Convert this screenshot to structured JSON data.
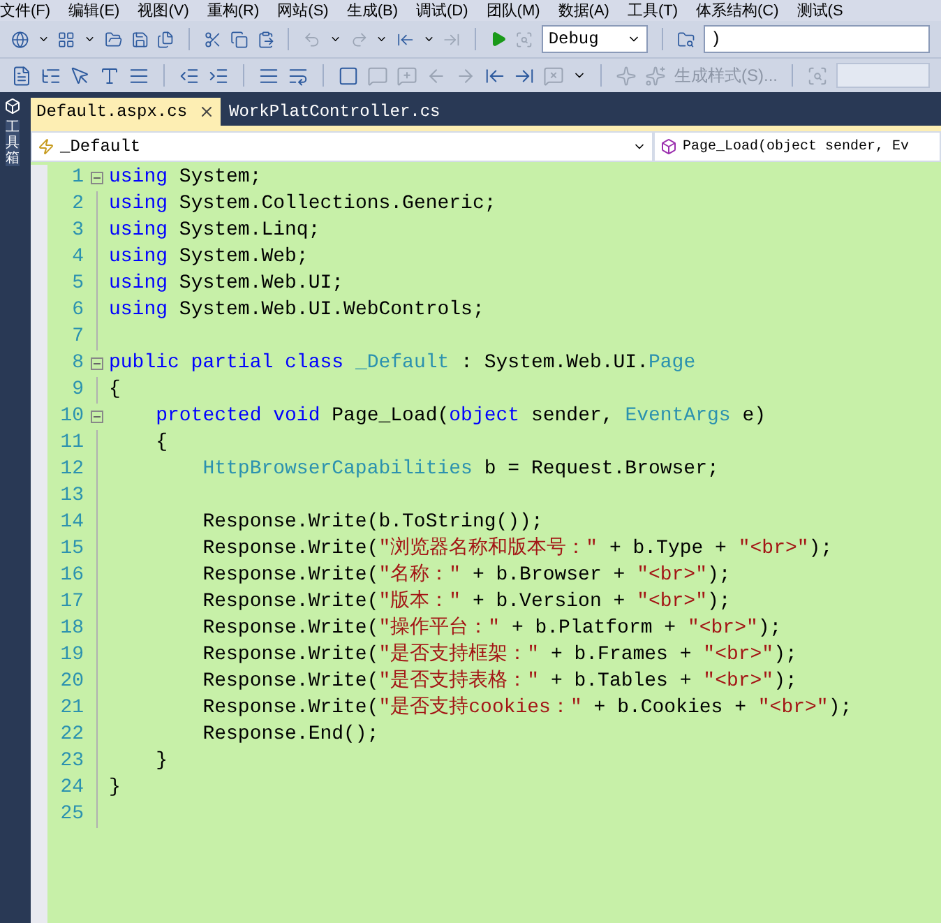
{
  "menu": [
    "文件(F)",
    "编辑(E)",
    "视图(V)",
    "重构(R)",
    "网站(S)",
    "生成(B)",
    "调试(D)",
    "团队(M)",
    "数据(A)",
    "工具(T)",
    "体系结构(C)",
    "测试(S"
  ],
  "toolbar": {
    "configuration": "Debug",
    "find_value": ")",
    "build_style": {
      "label": "生成样式(S)...",
      "disabled": true
    }
  },
  "toolbox_tab": "工具箱",
  "tabs": [
    {
      "label": "Default.aspx.cs",
      "selected": true
    },
    {
      "label": "WorkPlatController.cs",
      "selected": false
    }
  ],
  "nav": {
    "class": "_Default",
    "member": "Page_Load(object sender, Ev"
  },
  "code": [
    {
      "n": "1",
      "fold": true,
      "tokens": [
        {
          "kind": "kw",
          "text": "using"
        },
        {
          "kind": "plain",
          "text": " System;"
        }
      ]
    },
    {
      "n": "2",
      "fold": false,
      "tokens": [
        {
          "kind": "kw",
          "text": "using"
        },
        {
          "kind": "plain",
          "text": " System.Collections.Generic;"
        }
      ]
    },
    {
      "n": "3",
      "fold": false,
      "tokens": [
        {
          "kind": "kw",
          "text": "using"
        },
        {
          "kind": "plain",
          "text": " System.Linq;"
        }
      ]
    },
    {
      "n": "4",
      "fold": false,
      "tokens": [
        {
          "kind": "kw",
          "text": "using"
        },
        {
          "kind": "plain",
          "text": " System.Web;"
        }
      ]
    },
    {
      "n": "5",
      "fold": false,
      "tokens": [
        {
          "kind": "kw",
          "text": "using"
        },
        {
          "kind": "plain",
          "text": " System.Web.UI;"
        }
      ]
    },
    {
      "n": "6",
      "fold": false,
      "tokens": [
        {
          "kind": "kw",
          "text": "using"
        },
        {
          "kind": "plain",
          "text": " System.Web.UI.WebControls;"
        }
      ]
    },
    {
      "n": "7",
      "fold": false
    },
    {
      "n": "8",
      "fold": true,
      "tokens": [
        {
          "kind": "kw",
          "text": "public partial class "
        },
        {
          "kind": "type",
          "text": "_Default"
        },
        {
          "kind": "plain",
          "text": " : System.Web.UI."
        },
        {
          "kind": "type",
          "text": "Page"
        }
      ]
    },
    {
      "n": "9",
      "fold": false,
      "tokens": [
        {
          "kind": "plain",
          "text": "{"
        }
      ]
    },
    {
      "n": "10",
      "fold": true,
      "tokens": [
        {
          "kind": "kw",
          "text": "    protected void"
        },
        {
          "kind": "plain",
          "text": " Page_Load("
        },
        {
          "kind": "kw",
          "text": "object"
        },
        {
          "kind": "plain",
          "text": " sender, "
        },
        {
          "kind": "type",
          "text": "EventArgs"
        },
        {
          "kind": "plain",
          "text": " e)"
        }
      ]
    },
    {
      "n": "11",
      "fold": false,
      "tokens": [
        {
          "kind": "plain",
          "text": "    {"
        }
      ]
    },
    {
      "n": "12",
      "fold": false,
      "tokens": [
        {
          "kind": "type",
          "text": "        HttpBrowserCapabilities"
        },
        {
          "kind": "plain",
          "text": " b = Request.Browser;"
        }
      ]
    },
    {
      "n": "13",
      "fold": false
    },
    {
      "n": "14",
      "fold": false,
      "tokens": [
        {
          "kind": "plain",
          "text": "        Response.Write(b.ToString());"
        }
      ]
    },
    {
      "n": "15",
      "fold": false,
      "tokens": [
        {
          "kind": "plain",
          "text": "        Response.Write("
        },
        {
          "kind": "str",
          "text": "\"浏览器名称和版本号：\""
        },
        {
          "kind": "plain",
          "text": " + b.Type + "
        },
        {
          "kind": "str",
          "text": "\"<br>\""
        },
        {
          "kind": "plain",
          "text": ");"
        }
      ]
    },
    {
      "n": "16",
      "fold": false,
      "tokens": [
        {
          "kind": "plain",
          "text": "        Response.Write("
        },
        {
          "kind": "str",
          "text": "\"名称：\""
        },
        {
          "kind": "plain",
          "text": " + b.Browser + "
        },
        {
          "kind": "str",
          "text": "\"<br>\""
        },
        {
          "kind": "plain",
          "text": ");"
        }
      ]
    },
    {
      "n": "17",
      "fold": false,
      "tokens": [
        {
          "kind": "plain",
          "text": "        Response.Write("
        },
        {
          "kind": "str",
          "text": "\"版本：\""
        },
        {
          "kind": "plain",
          "text": " + b.Version + "
        },
        {
          "kind": "str",
          "text": "\"<br>\""
        },
        {
          "kind": "plain",
          "text": ");"
        }
      ]
    },
    {
      "n": "18",
      "fold": false,
      "tokens": [
        {
          "kind": "plain",
          "text": "        Response.Write("
        },
        {
          "kind": "str",
          "text": "\"操作平台：\""
        },
        {
          "kind": "plain",
          "text": " + b.Platform + "
        },
        {
          "kind": "str",
          "text": "\"<br>\""
        },
        {
          "kind": "plain",
          "text": ");"
        }
      ]
    },
    {
      "n": "19",
      "fold": false,
      "tokens": [
        {
          "kind": "plain",
          "text": "        Response.Write("
        },
        {
          "kind": "str",
          "text": "\"是否支持框架：\""
        },
        {
          "kind": "plain",
          "text": " + b.Frames + "
        },
        {
          "kind": "str",
          "text": "\"<br>\""
        },
        {
          "kind": "plain",
          "text": ");"
        }
      ]
    },
    {
      "n": "20",
      "fold": false,
      "tokens": [
        {
          "kind": "plain",
          "text": "        Response.Write("
        },
        {
          "kind": "str",
          "text": "\"是否支持表格：\""
        },
        {
          "kind": "plain",
          "text": " + b.Tables + "
        },
        {
          "kind": "str",
          "text": "\"<br>\""
        },
        {
          "kind": "plain",
          "text": ");"
        }
      ]
    },
    {
      "n": "21",
      "fold": false,
      "tokens": [
        {
          "kind": "plain",
          "text": "        Response.Write("
        },
        {
          "kind": "str",
          "text": "\"是否支持cookies：\""
        },
        {
          "kind": "plain",
          "text": " + b.Cookies + "
        },
        {
          "kind": "str",
          "text": "\"<br>\""
        },
        {
          "kind": "plain",
          "text": ");"
        }
      ]
    },
    {
      "n": "22",
      "fold": false,
      "tokens": [
        {
          "kind": "plain",
          "text": "        Response.End();"
        }
      ]
    },
    {
      "n": "23",
      "fold": false,
      "tokens": [
        {
          "kind": "plain",
          "text": "    }"
        }
      ]
    },
    {
      "n": "24",
      "fold": false,
      "tokens": [
        {
          "kind": "plain",
          "text": "}"
        }
      ]
    },
    {
      "n": "25",
      "fold": false
    }
  ]
}
